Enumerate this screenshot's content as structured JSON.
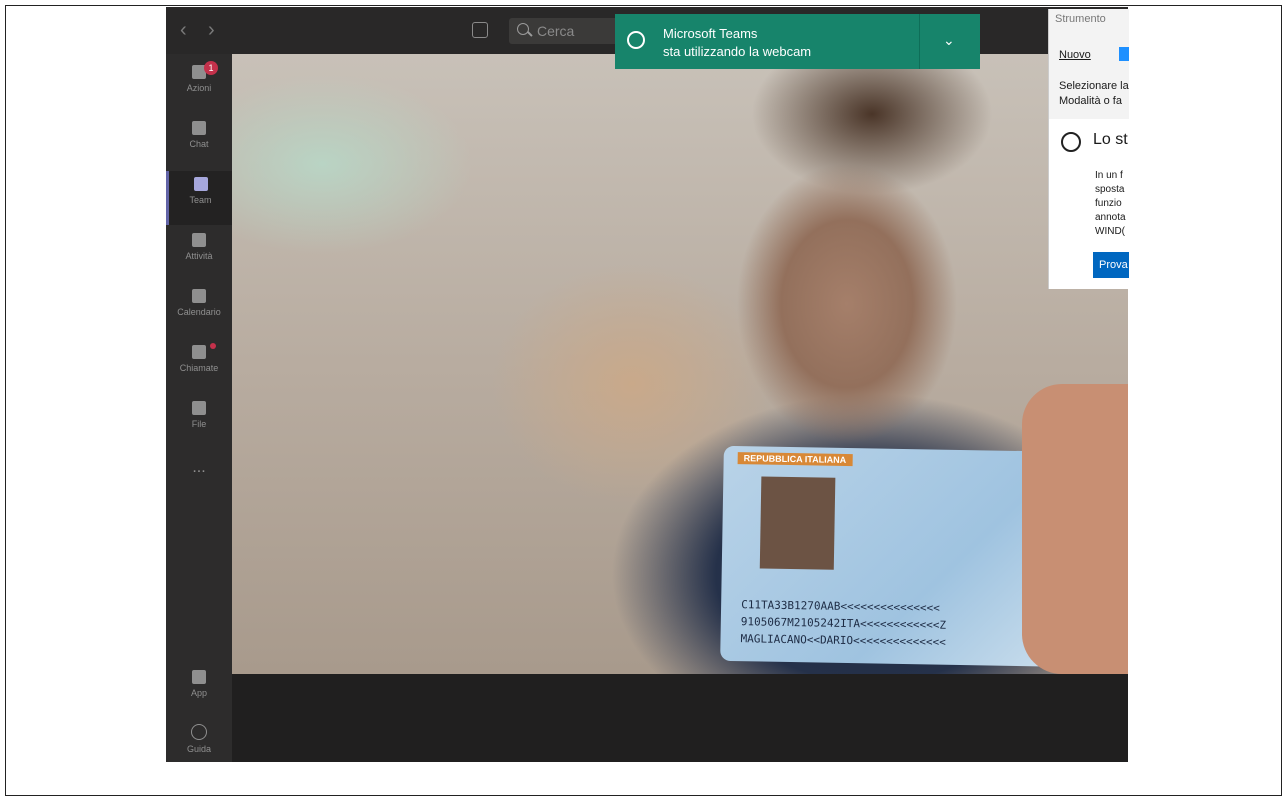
{
  "nav": {
    "back": "‹",
    "forward": "›"
  },
  "search": {
    "placeholder": "Cerca"
  },
  "rail": [
    {
      "label": "Azioni",
      "badge": "1"
    },
    {
      "label": "Chat"
    },
    {
      "label": "Team",
      "active": true
    },
    {
      "label": "Attività"
    },
    {
      "label": "Calendario"
    },
    {
      "label": "Chiamate",
      "dot": true
    },
    {
      "label": "File"
    },
    {
      "label": "..."
    }
  ],
  "rail_bottom": [
    {
      "label": "App"
    },
    {
      "label": "Guida"
    }
  ],
  "toast": {
    "app": "Microsoft Teams",
    "message": "sta utilizzando la webcam",
    "chevron": "⌄"
  },
  "card": {
    "header": "REPUBBLICA ITALIANA",
    "mrz": [
      "C11TA33B1270AAB<<<<<<<<<<<<<<<",
      "9105067M2105242ITA<<<<<<<<<<<<Z",
      "MAGLIACANO<<DARIO<<<<<<<<<<<<<<"
    ]
  },
  "snip": {
    "title": "Strumento",
    "new_label": "Nuovo",
    "line1": "Selezionare la",
    "line2": "Modalità o fa",
    "heading": "Lo st",
    "body": [
      "In un f",
      "sposta",
      "funzio",
      "annota",
      "WIND("
    ],
    "button": "Prova"
  },
  "colors": {
    "accent": "#6264a7",
    "toast": "#17846b",
    "badge": "#c4314b"
  }
}
